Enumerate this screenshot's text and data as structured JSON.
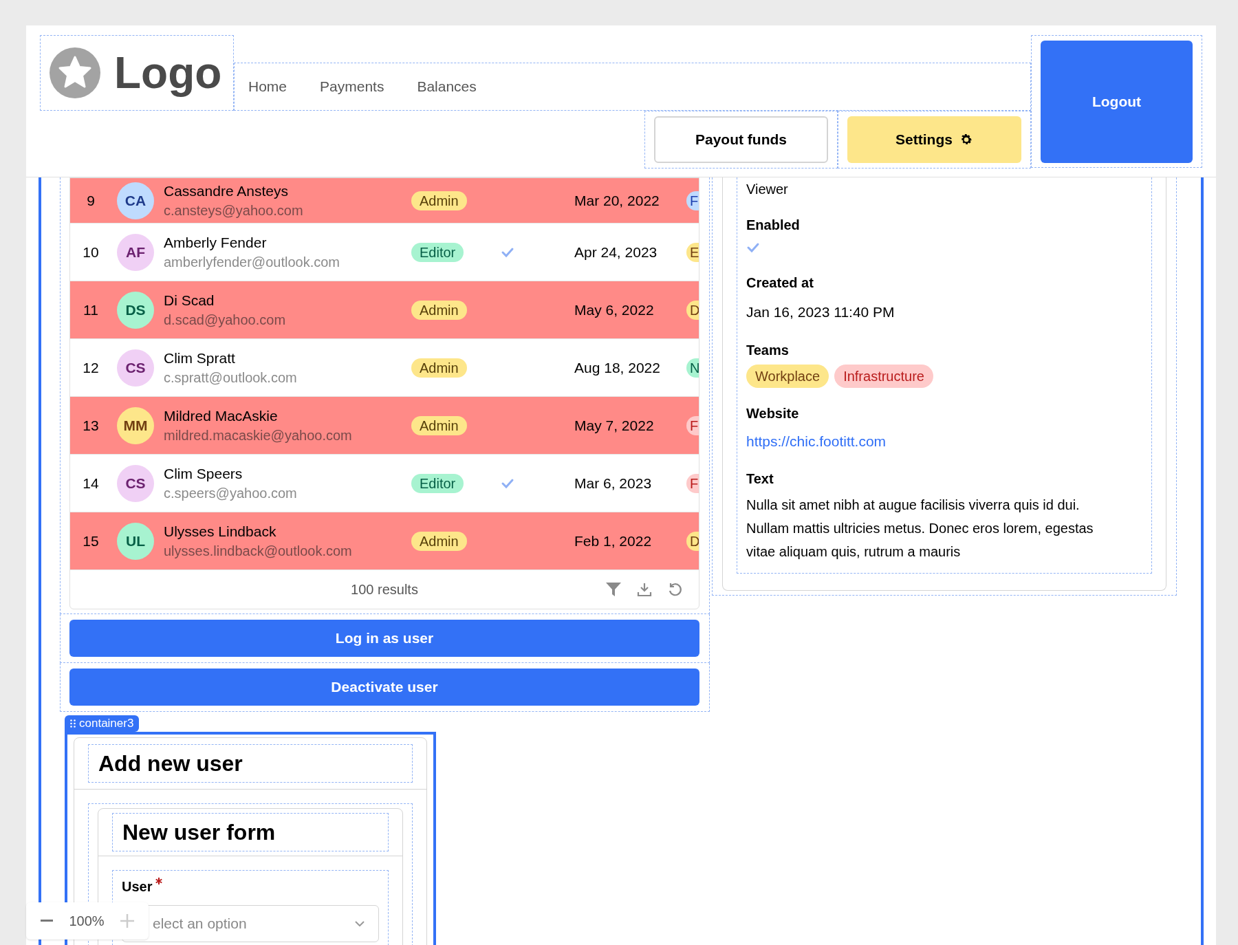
{
  "header": {
    "logo_text": "Logo",
    "nav": [
      {
        "label": "Home"
      },
      {
        "label": "Payments"
      },
      {
        "label": "Balances"
      }
    ],
    "buttons": [
      {
        "label": "Payout funds",
        "kind": "outline"
      },
      {
        "label": "Settings",
        "kind": "yellow"
      }
    ],
    "logout": "Logout"
  },
  "table": {
    "rows": [
      {
        "num": "9",
        "avatar": {
          "initials": "CA",
          "color": "#bfdbfe"
        },
        "name": "Cassandre Ansteys",
        "email": "c.ansteys@yahoo.com",
        "role": {
          "label": "Admin",
          "kind": "admin"
        },
        "enabled": false,
        "date": "Mar 20, 2022",
        "tag": {
          "label": "F",
          "color": "#bfdbfe"
        },
        "highlighted": true
      },
      {
        "num": "10",
        "avatar": {
          "initials": "AF",
          "color": "#f0d0f5"
        },
        "name": "Amberly Fender",
        "email": "amberlyfender@outlook.com",
        "role": {
          "label": "Editor",
          "kind": "editor"
        },
        "enabled": true,
        "date": "Apr 24, 2023",
        "tag": {
          "label": "E",
          "color": "#fde68a"
        },
        "highlighted": false
      },
      {
        "num": "11",
        "avatar": {
          "initials": "DS",
          "color": "#a7f3d0"
        },
        "name": "Di Scad",
        "email": "d.scad@yahoo.com",
        "role": {
          "label": "Admin",
          "kind": "admin"
        },
        "enabled": false,
        "date": "May 6, 2022",
        "tag": {
          "label": "D",
          "color": "#fde68a"
        },
        "highlighted": true
      },
      {
        "num": "12",
        "avatar": {
          "initials": "CS",
          "color": "#f0d0f5"
        },
        "name": "Clim Spratt",
        "email": "c.spratt@outlook.com",
        "role": {
          "label": "Admin",
          "kind": "admin"
        },
        "enabled": false,
        "date": "Aug 18, 2022",
        "tag": {
          "label": "N",
          "color": "#a7f3d0"
        },
        "highlighted": false
      },
      {
        "num": "13",
        "avatar": {
          "initials": "MM",
          "color": "#fde68a"
        },
        "name": "Mildred MacAskie",
        "email": "mildred.macaskie@yahoo.com",
        "role": {
          "label": "Admin",
          "kind": "admin"
        },
        "enabled": false,
        "date": "May 7, 2022",
        "tag": {
          "label": "F",
          "color": "#fecaca"
        },
        "highlighted": true
      },
      {
        "num": "14",
        "avatar": {
          "initials": "CS",
          "color": "#f0d0f5"
        },
        "name": "Clim Speers",
        "email": "c.speers@yahoo.com",
        "role": {
          "label": "Editor",
          "kind": "editor"
        },
        "enabled": true,
        "date": "Mar 6, 2023",
        "tag": {
          "label": "F",
          "color": "#fecaca"
        },
        "highlighted": false
      },
      {
        "num": "15",
        "avatar": {
          "initials": "UL",
          "color": "#a7f3d0"
        },
        "name": "Ulysses Lindback",
        "email": "ulysses.lindback@outlook.com",
        "role": {
          "label": "Admin",
          "kind": "admin"
        },
        "enabled": false,
        "date": "Feb 1, 2022",
        "tag": {
          "label": "D",
          "color": "#fde68a"
        },
        "highlighted": true
      }
    ],
    "results": "100 results"
  },
  "actions": [
    "Log in as user",
    "Deactivate user"
  ],
  "container_badge": "container3",
  "add_user": {
    "title": "Add new user",
    "form_title": "New user form",
    "field_label": "User",
    "required": true,
    "placeholder": "elect an option"
  },
  "details": {
    "role_value": "Viewer",
    "enabled_label": "Enabled",
    "enabled": true,
    "created_label": "Created at",
    "created_value": "Jan 16, 2023 11:40 PM",
    "teams_label": "Teams",
    "teams": [
      {
        "label": "Workplace",
        "color": "#fde68a"
      },
      {
        "label": "Infrastructure",
        "color": "#fecaca"
      }
    ],
    "website_label": "Website",
    "website": "https://chic.footitt.com",
    "text_label": "Text",
    "text": "Nulla sit amet nibh at augue facilisis viverra quis id dui. Nullam mattis ultricies metus. Donec eros lorem, egestas vitae aliquam quis, rutrum a mauris"
  },
  "zoom": {
    "value": "100%"
  }
}
